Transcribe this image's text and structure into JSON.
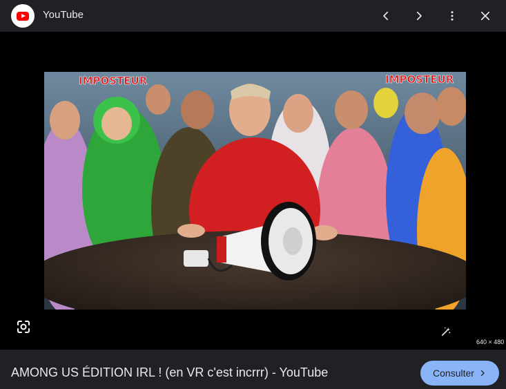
{
  "header": {
    "site_name": "YouTube",
    "icons": {
      "logo": "youtube-logo-icon",
      "prev": "chevron-left-icon",
      "next": "chevron-right-icon",
      "more": "more-vert-icon",
      "close": "close-icon"
    }
  },
  "viewer": {
    "image_text_left": "IMPOSTEUR",
    "image_text_right": "IMPOSTEUR",
    "dimensions": "640 × 480",
    "icons": {
      "lens": "google-lens-icon",
      "enhance": "magic-wand-icon"
    }
  },
  "footer": {
    "title": "AMONG US ÉDITION IRL ! (en VR c'est incrrr) - YouTube",
    "visit_label": "Consulter",
    "visit_icon": "chevron-right-icon"
  },
  "colors": {
    "bar_bg": "#202124",
    "viewer_bg": "#000000",
    "accent": "#8ab4f8",
    "brand_red": "#ff0000",
    "imposteur_red": "#e01818"
  }
}
